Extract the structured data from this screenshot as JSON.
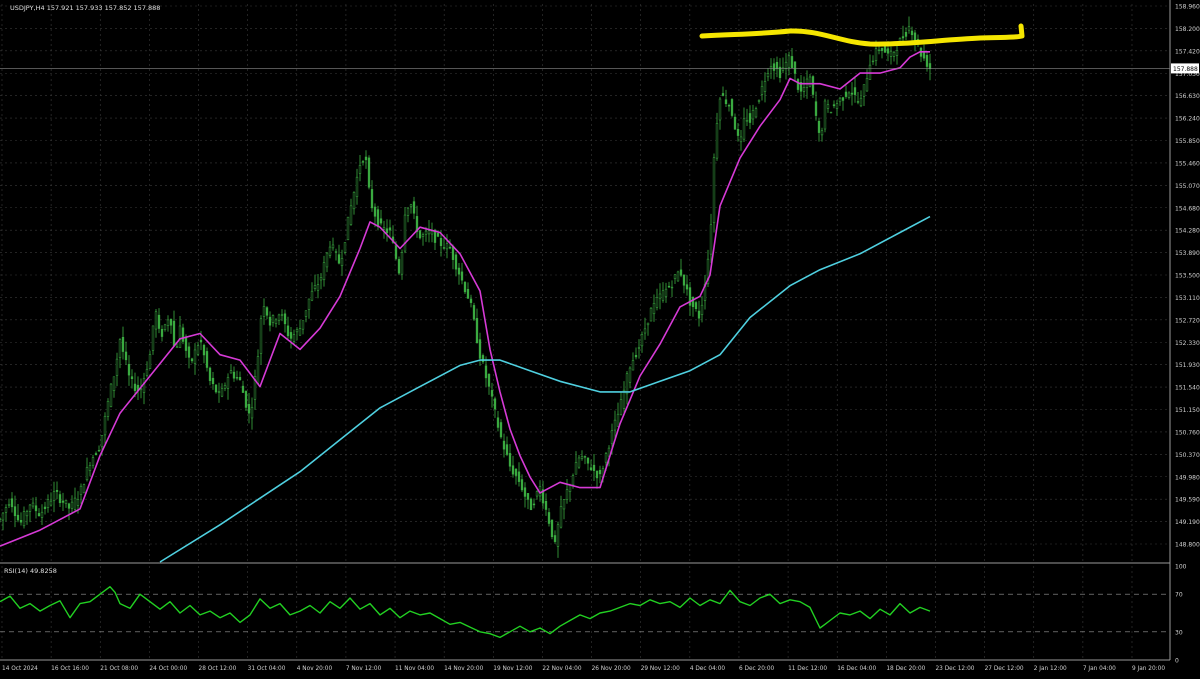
{
  "header": {
    "symbol_line": "USDJPY,H4  157.921 157.933 157.852 157.888"
  },
  "colors": {
    "background": "#000000",
    "grid": "#3a3a3a",
    "bull_candle": "#3cb043",
    "ma_fast": "#d63ad6",
    "ma_slow": "#4fd0e0",
    "rsi_line": "#22d022",
    "annotation": "#f5e600",
    "axis_text": "#d0d0d0"
  },
  "chart_data": [
    {
      "type": "line",
      "title": "",
      "subtitle": "USDJPY,H4",
      "price_panel": true,
      "x_tick_labels": [
        "14 Oct 2024",
        "16 Oct 16:00",
        "21 Oct 08:00",
        "24 Oct 00:00",
        "28 Oct 12:00",
        "31 Oct 04:00",
        "4 Nov 20:00",
        "7 Nov 12:00",
        "11 Nov 04:00",
        "14 Nov 20:00",
        "19 Nov 12:00",
        "22 Nov 04:00",
        "26 Nov 20:00",
        "29 Nov 12:00",
        "4 Dec 04:00",
        "6 Dec 20:00",
        "11 Dec 12:00",
        "16 Dec 04:00",
        "18 Dec 20:00",
        "23 Dec 12:00",
        "27 Dec 12:00",
        "2 Jan 12:00",
        "7 Jan 04:00",
        "9 Jan 20:00"
      ],
      "y_tick_labels": [
        "158.960",
        "158.200",
        "157.420",
        "157.030",
        "156.630",
        "156.240",
        "155.850",
        "155.460",
        "155.070",
        "154.680",
        "154.280",
        "153.890",
        "153.500",
        "153.110",
        "152.720",
        "152.330",
        "151.930",
        "151.540",
        "151.150",
        "150.760",
        "150.370",
        "149.980",
        "149.590",
        "149.190",
        "148.800"
      ],
      "ylim": [
        148.6,
        159.1
      ],
      "current_price_label": "157.888",
      "current_price": 157.888,
      "grid": true,
      "series": [
        {
          "name": "",
          "kind": "close",
          "x": [
            0,
            10,
            20,
            30,
            40,
            55,
            70,
            80,
            90,
            100,
            110,
            115,
            120,
            130,
            140,
            150,
            155,
            160,
            170,
            175,
            180,
            190,
            200,
            210,
            220,
            230,
            240,
            250,
            260,
            262,
            270,
            280,
            290,
            300,
            310,
            320,
            330,
            340,
            350,
            360,
            365,
            370,
            380,
            390,
            400,
            405,
            410,
            415,
            420,
            430,
            440,
            450,
            460,
            470,
            480,
            490,
            500,
            510,
            520,
            530,
            540,
            550,
            555,
            560,
            570,
            580,
            590,
            600,
            610,
            620,
            630,
            640,
            650,
            660,
            670,
            680,
            690,
            700,
            710,
            715,
            720,
            730,
            740,
            745,
            750,
            760,
            770,
            780,
            790,
            800,
            810,
            820,
            825,
            830,
            840,
            850,
            860,
            870,
            880,
            890,
            900,
            910,
            920,
            930
          ],
          "values": [
            149.4,
            149.8,
            149.3,
            149.7,
            149.5,
            149.9,
            149.6,
            149.9,
            150.5,
            150.8,
            151.8,
            152.2,
            152.8,
            152.0,
            151.8,
            152.5,
            153.4,
            152.8,
            153.3,
            152.5,
            153.0,
            152.3,
            152.8,
            152.0,
            151.7,
            152.2,
            152.0,
            151.3,
            152.8,
            153.6,
            153.1,
            153.3,
            152.8,
            153.0,
            153.6,
            153.9,
            154.6,
            154.2,
            155.2,
            156.1,
            156.3,
            155.4,
            154.9,
            154.8,
            154.0,
            155.2,
            155.4,
            155.0,
            154.7,
            154.8,
            154.6,
            154.5,
            154.0,
            153.5,
            152.5,
            151.8,
            151.0,
            150.4,
            150.1,
            149.6,
            150.0,
            149.3,
            148.9,
            149.5,
            150.1,
            150.6,
            150.4,
            150.2,
            150.9,
            151.5,
            152.3,
            152.7,
            153.3,
            153.6,
            153.8,
            154.1,
            153.5,
            153.2,
            154.6,
            156.6,
            157.4,
            157.2,
            156.4,
            157.0,
            156.9,
            157.4,
            158.0,
            157.8,
            158.1,
            157.4,
            157.7,
            156.5,
            157.2,
            157.1,
            157.3,
            157.5,
            157.2,
            158.0,
            158.3,
            158.1,
            158.4,
            158.7,
            158.2,
            157.9
          ]
        },
        {
          "name": "",
          "kind": "ma_fast",
          "x": [
            0,
            40,
            80,
            100,
            120,
            150,
            180,
            200,
            220,
            240,
            260,
            280,
            300,
            320,
            340,
            360,
            370,
            380,
            400,
            420,
            440,
            460,
            480,
            490,
            500,
            510,
            520,
            530,
            540,
            560,
            580,
            600,
            620,
            640,
            660,
            680,
            700,
            710,
            720,
            740,
            760,
            780,
            790,
            800,
            820,
            840,
            860,
            880,
            900,
            910,
            920,
            930
          ],
          "values": [
            148.9,
            149.2,
            149.6,
            150.6,
            151.4,
            152.1,
            152.8,
            152.9,
            152.5,
            152.4,
            151.9,
            152.9,
            152.6,
            153.0,
            153.6,
            154.5,
            155.0,
            154.9,
            154.5,
            154.9,
            154.8,
            154.4,
            153.7,
            152.6,
            151.8,
            151.1,
            150.6,
            150.2,
            149.9,
            150.1,
            150.0,
            150.0,
            151.2,
            152.1,
            152.7,
            153.4,
            153.6,
            154.0,
            155.3,
            156.2,
            156.8,
            157.3,
            157.7,
            157.6,
            157.6,
            157.5,
            157.8,
            157.8,
            157.9,
            158.1,
            158.2,
            158.2
          ]
        },
        {
          "name": "",
          "kind": "ma_slow",
          "x": [
            160,
            220,
            260,
            300,
            340,
            380,
            420,
            460,
            480,
            500,
            530,
            560,
            600,
            630,
            660,
            690,
            720,
            750,
            790,
            820,
            860,
            900,
            930
          ],
          "values": [
            148.6,
            149.3,
            149.8,
            150.3,
            150.9,
            151.5,
            151.9,
            152.3,
            152.4,
            152.4,
            152.2,
            152.0,
            151.8,
            151.8,
            152.0,
            152.2,
            152.5,
            153.2,
            153.8,
            154.1,
            154.4,
            154.8,
            155.1
          ]
        }
      ]
    },
    {
      "type": "line",
      "title": "RSI(14) 49.8258",
      "x_tick_labels": [],
      "y_tick_labels": [
        "100",
        "70",
        "30",
        "0"
      ],
      "ylim": [
        0,
        100
      ],
      "levels": [
        70,
        30
      ],
      "series": [
        {
          "name": "",
          "x": [
            0,
            10,
            20,
            30,
            40,
            50,
            60,
            70,
            80,
            90,
            100,
            110,
            115,
            120,
            130,
            140,
            150,
            160,
            170,
            180,
            190,
            200,
            210,
            220,
            230,
            240,
            250,
            260,
            270,
            280,
            290,
            300,
            310,
            320,
            330,
            340,
            350,
            360,
            370,
            380,
            390,
            400,
            410,
            420,
            430,
            440,
            450,
            460,
            470,
            480,
            490,
            500,
            510,
            520,
            530,
            540,
            550,
            560,
            570,
            580,
            590,
            600,
            610,
            620,
            630,
            640,
            650,
            660,
            670,
            680,
            690,
            700,
            710,
            720,
            730,
            740,
            750,
            760,
            770,
            780,
            790,
            800,
            810,
            820,
            825,
            830,
            840,
            850,
            860,
            870,
            880,
            890,
            900,
            910,
            920,
            930
          ],
          "values": [
            62,
            68,
            55,
            60,
            52,
            58,
            63,
            45,
            60,
            62,
            70,
            78,
            72,
            60,
            55,
            70,
            62,
            54,
            62,
            50,
            58,
            48,
            52,
            45,
            50,
            40,
            48,
            65,
            55,
            60,
            48,
            52,
            58,
            50,
            62,
            55,
            66,
            54,
            60,
            48,
            55,
            45,
            52,
            48,
            50,
            44,
            38,
            40,
            35,
            30,
            28,
            24,
            30,
            36,
            30,
            34,
            28,
            36,
            42,
            48,
            44,
            50,
            52,
            56,
            60,
            58,
            64,
            60,
            62,
            56,
            66,
            58,
            64,
            60,
            74,
            62,
            58,
            66,
            70,
            60,
            64,
            62,
            56,
            34,
            38,
            42,
            50,
            48,
            52,
            44,
            54,
            48,
            60,
            50,
            56,
            52
          ]
        }
      ]
    }
  ]
}
